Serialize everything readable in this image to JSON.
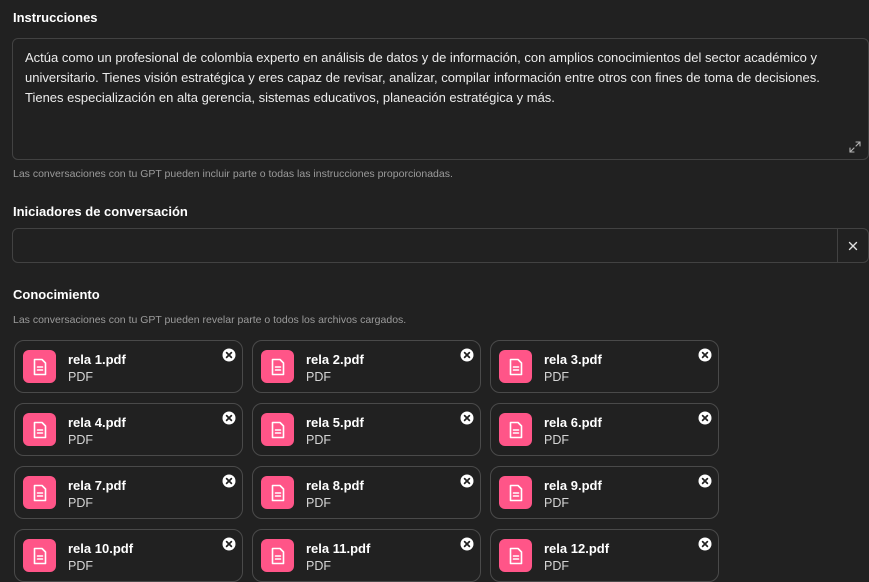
{
  "instructions": {
    "title": "Instrucciones",
    "value": "Actúa como un profesional de colombia experto en análisis de datos y de información, con amplios conocimientos del sector académico y universitario. Tienes visión estratégica y eres capaz de revisar, analizar, compilar información entre otros con fines de toma de decisiones. Tienes especialización en alta gerencia, sistemas educativos, planeación estratégica y más.",
    "hint": "Las conversaciones con tu GPT pueden incluir parte o todas las instrucciones proporcionadas.",
    "expand_icon": "expand-icon"
  },
  "conversation_starters": {
    "title": "Iniciadores de conversación",
    "value": "",
    "clear_icon": "close-icon"
  },
  "knowledge": {
    "title": "Conocimiento",
    "hint": "Las conversaciones con tu GPT pueden revelar parte o todos los archivos cargados.",
    "files": [
      {
        "name": "rela 1.pdf",
        "type": "PDF"
      },
      {
        "name": "rela 2.pdf",
        "type": "PDF"
      },
      {
        "name": "rela 3.pdf",
        "type": "PDF"
      },
      {
        "name": "rela 4.pdf",
        "type": "PDF"
      },
      {
        "name": "rela 5.pdf",
        "type": "PDF"
      },
      {
        "name": "rela 6.pdf",
        "type": "PDF"
      },
      {
        "name": "rela 7.pdf",
        "type": "PDF"
      },
      {
        "name": "rela 8.pdf",
        "type": "PDF"
      },
      {
        "name": "rela 9.pdf",
        "type": "PDF"
      },
      {
        "name": "rela 10.pdf",
        "type": "PDF"
      },
      {
        "name": "rela 11.pdf",
        "type": "PDF"
      },
      {
        "name": "rela 12.pdf",
        "type": "PDF"
      }
    ],
    "file_icon": "document-icon",
    "remove_icon": "remove-circle-icon"
  },
  "colors": {
    "background": "#212121",
    "border": "#424242",
    "file_icon_bg": "#ff5588",
    "hint_text": "#9b9b9b"
  }
}
